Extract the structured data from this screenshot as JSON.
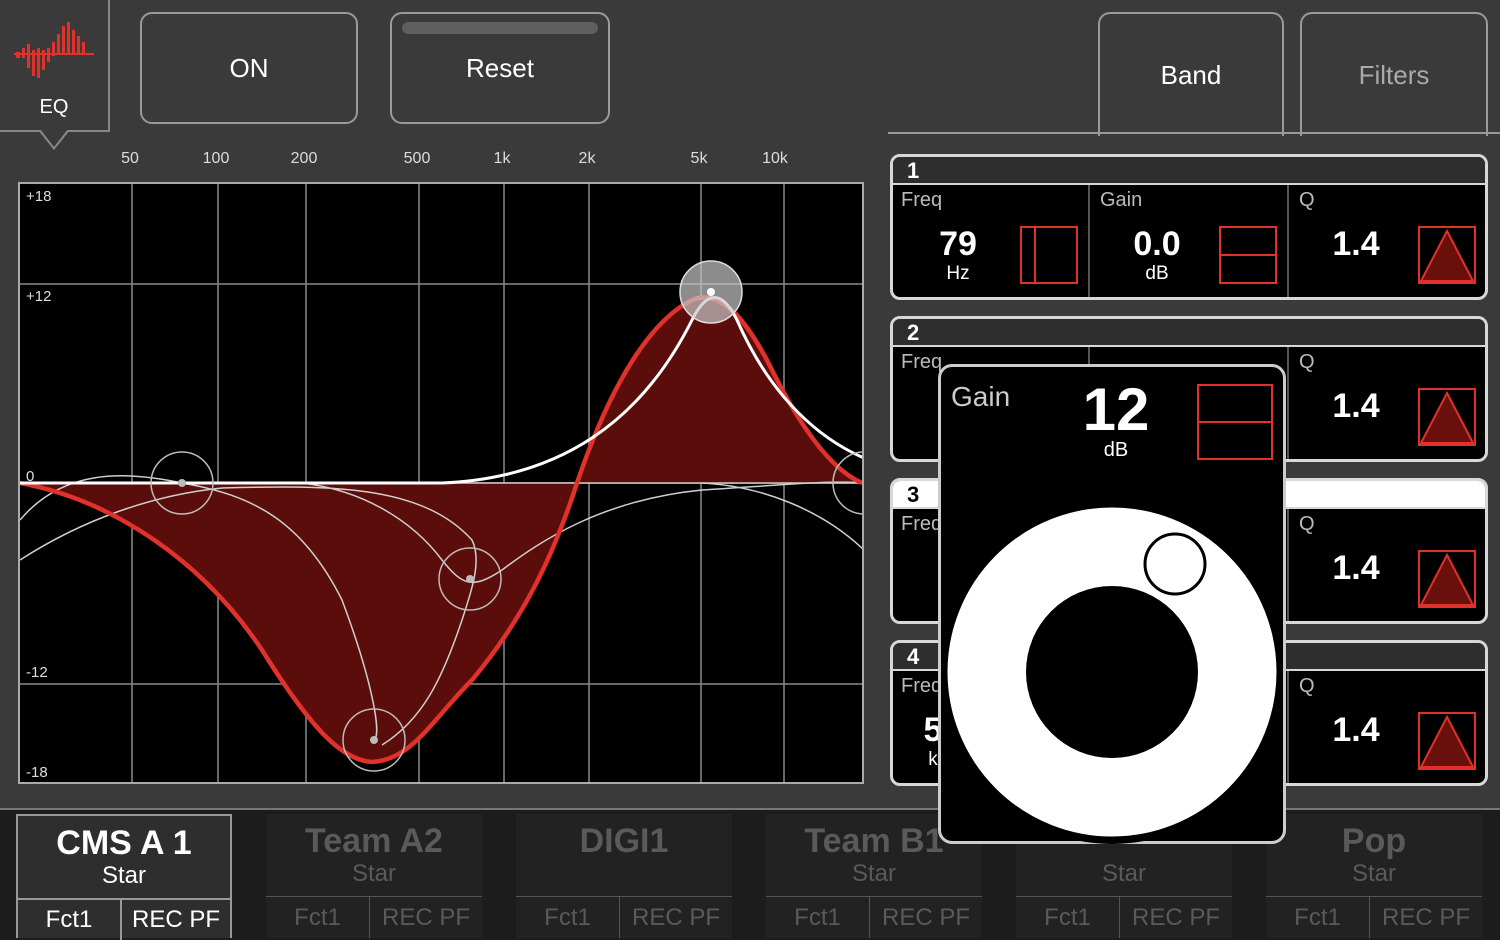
{
  "toolbar": {
    "eq_label": "EQ",
    "on_label": "ON",
    "reset_label": "Reset",
    "tabs": [
      {
        "label": "Band",
        "active": true
      },
      {
        "label": "Filters",
        "active": false
      }
    ]
  },
  "graph": {
    "freq_labels": [
      "50",
      "100",
      "200",
      "500",
      "1k",
      "2k",
      "5k",
      "10k"
    ],
    "gain_labels": [
      "+18",
      "+12",
      "0",
      "-12",
      "-18"
    ]
  },
  "bands": [
    {
      "number": "1",
      "freq_label": "Freq",
      "freq_value": "79",
      "freq_unit": "Hz",
      "gain_label": "Gain",
      "gain_value": "0.0",
      "gain_unit": "dB",
      "q_label": "Q",
      "q_value": "1.4"
    },
    {
      "number": "2",
      "freq_label": "Freq",
      "q_label": "Q",
      "q_value": "1.4"
    },
    {
      "number": "3",
      "freq_label": "Freq",
      "q_label": "Q",
      "q_value": "1.4"
    },
    {
      "number": "4",
      "freq_label": "Freq",
      "freq_value": "5",
      "freq_unit": "k",
      "q_label": "Q",
      "q_value": "1.4"
    }
  ],
  "popup": {
    "label": "Gain",
    "value": "12",
    "unit": "dB"
  },
  "channels": [
    {
      "name": "CMS A 1",
      "sub": "Star",
      "fct": "Fct1",
      "rec": "REC PF",
      "active": true
    },
    {
      "name": "Team A2",
      "sub": "Star",
      "fct": "Fct1",
      "rec": "REC PF",
      "active": false
    },
    {
      "name": "DIGI1",
      "sub": "",
      "fct": "Fct1",
      "rec": "REC PF",
      "active": false
    },
    {
      "name": "Team B1",
      "sub": "Star",
      "fct": "Fct1",
      "rec": "REC PF",
      "active": false
    },
    {
      "name": "",
      "sub": "Star",
      "fct": "Fct1",
      "rec": "REC PF",
      "active": false
    },
    {
      "name": "Pop",
      "sub": "Star",
      "fct": "Fct1",
      "rec": "REC PF",
      "active": false
    }
  ],
  "colors": {
    "accent_red": "#e0312b",
    "fill_red": "#5a0d0a",
    "background": "#3a3a3a"
  }
}
